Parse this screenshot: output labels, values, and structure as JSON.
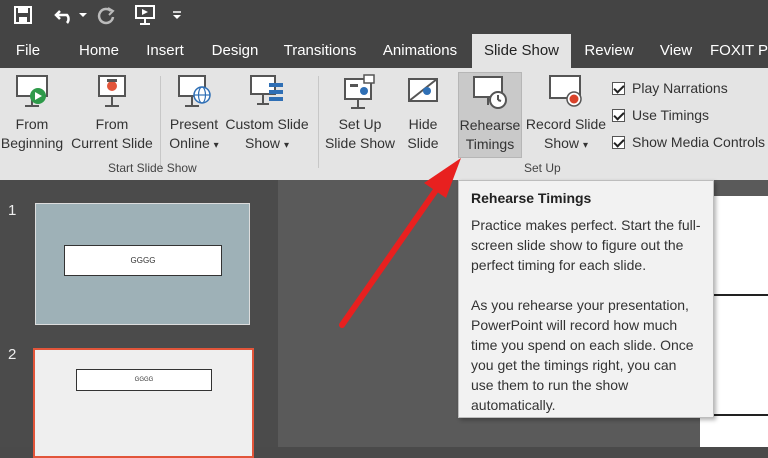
{
  "tabs": [
    "File",
    "Home",
    "Insert",
    "Design",
    "Transitions",
    "Animations",
    "Slide Show",
    "Review",
    "View",
    "FOXIT P"
  ],
  "active_tab": "Slide Show",
  "ribbon": {
    "from_beginning": [
      "From",
      "Beginning"
    ],
    "from_current": [
      "From",
      "Current Slide"
    ],
    "present_online": [
      "Present",
      "Online"
    ],
    "custom_show": [
      "Custom Slide",
      "Show"
    ],
    "group_start": "Start Slide Show",
    "set_up_show": [
      "Set Up",
      "Slide Show"
    ],
    "hide_slide": [
      "Hide",
      "Slide"
    ],
    "rehearse": [
      "Rehearse",
      "Timings"
    ],
    "record": [
      "Record Slide",
      "Show"
    ],
    "group_setup": "Set Up",
    "checks": [
      "Play Narrations",
      "Use Timings",
      "Show Media Controls"
    ],
    "dropdown_glyph": "▾"
  },
  "slides": [
    {
      "number": "1",
      "text": "GGGG"
    },
    {
      "number": "2",
      "text": "GGGG"
    }
  ],
  "tooltip": {
    "title": "Rehearse Timings",
    "p1": "Practice makes perfect. Start the full-screen slide show to figure out the perfect timing for each slide.",
    "p2": "As you rehearse your presentation, PowerPoint will record how much time you spend on each slide. Once you get the timings right, you can use them to run the show automatically."
  },
  "colors": {
    "annotation_arrow": "#e8201f",
    "accent_slide_border": "#e2553a"
  }
}
